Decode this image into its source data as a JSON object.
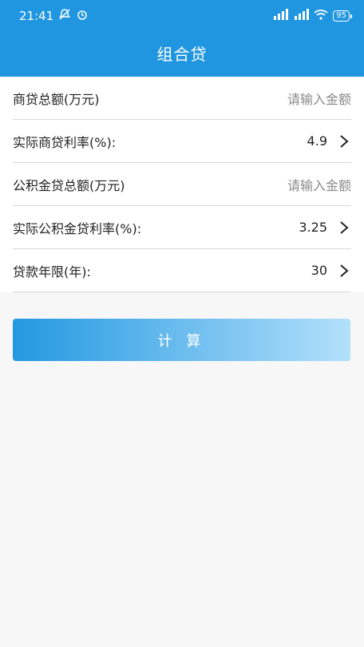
{
  "status_bar": {
    "time": "21:41",
    "battery": "95"
  },
  "header": {
    "title": "组合贷"
  },
  "form": {
    "rows": [
      {
        "label": "商贷总额(万元)",
        "placeholder": "请输入金额"
      },
      {
        "label": "实际商贷利率(%):",
        "value": "4.9"
      },
      {
        "label": "公积金贷总额(万元)",
        "placeholder": "请输入金额"
      },
      {
        "label": "实际公积金贷利率(%):",
        "value": "3.25"
      },
      {
        "label": "贷款年限(年):",
        "value": "30"
      }
    ]
  },
  "actions": {
    "calculate_label": "计 算"
  },
  "colors": {
    "primary": "#2196e0",
    "button_gradient_start": "#2398e1",
    "button_gradient_end": "#b3e0fb"
  }
}
